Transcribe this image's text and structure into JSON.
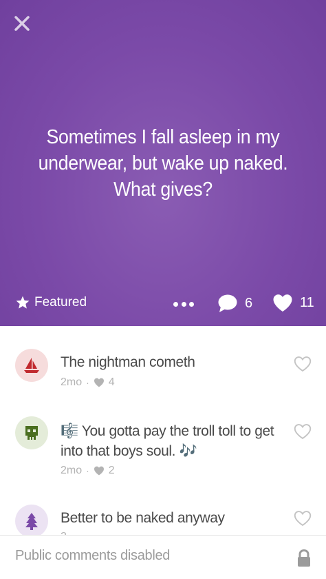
{
  "post": {
    "text": "Sometimes I fall asleep in my underwear, but wake up naked. What gives?",
    "featured_label": "Featured",
    "comment_count": "6",
    "like_count": "11"
  },
  "colors": {
    "hero_purple": "#7b4aa8",
    "avatar_red_bg": "#f6dcdc",
    "avatar_red": "#c0282d",
    "avatar_green_bg": "#e4ecd9",
    "avatar_green": "#4a6e1f",
    "avatar_purple_bg": "#ece3f3",
    "avatar_purple": "#7b4aa8"
  },
  "replies": [
    {
      "avatar_icon": "sailboat-icon",
      "text": "The nightman cometh",
      "age": "2mo",
      "likes": "4"
    },
    {
      "avatar_icon": "skull-icon",
      "text": "🎼 You gotta pay the troll toll to get into that boys soul. 🎶",
      "age": "2mo",
      "likes": "2"
    },
    {
      "avatar_icon": "pine-tree-icon",
      "text": "Better to be naked anyway",
      "age": "2",
      "likes": ""
    }
  ],
  "footer": {
    "status": "Public comments disabled"
  }
}
